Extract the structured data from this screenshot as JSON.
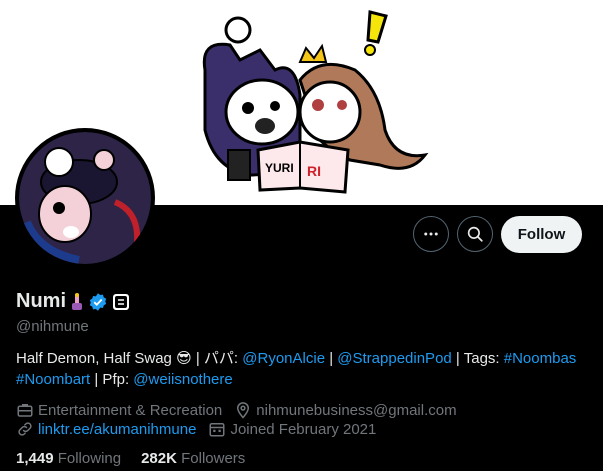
{
  "profile": {
    "name": "Numi",
    "handle": "@nihmune",
    "follow_label": "Follow",
    "bio": {
      "t1": "Half Demon, Half Swag 😎 | パパ: ",
      "m1": "@RyonAlcie",
      "t2": " | ",
      "m2": "@StrappedinPod",
      "t3": " | Tags: ",
      "h1": "#Noombas",
      "t4": " ",
      "h2": "#Noombart",
      "t5": " | Pfp: ",
      "m3": "@weiisnothere"
    },
    "category": "Entertainment & Recreation",
    "location": "nihmunebusiness@gmail.com",
    "website": "linktr.ee/akumanihmune",
    "joined": "Joined February 2021",
    "following_count": "1,449",
    "following_label": "Following",
    "followers_count": "282K",
    "followers_label": "Followers",
    "banner_text_1": "YURI",
    "banner_text_2": "RI"
  },
  "colors": {
    "accent": "#1d9bf0",
    "verified": "#1d9bf0",
    "secondary_text": "#71767b"
  },
  "icons": [
    "more-icon",
    "search-icon",
    "verified-badge-icon",
    "category-icon",
    "location-icon",
    "link-icon",
    "calendar-icon"
  ]
}
